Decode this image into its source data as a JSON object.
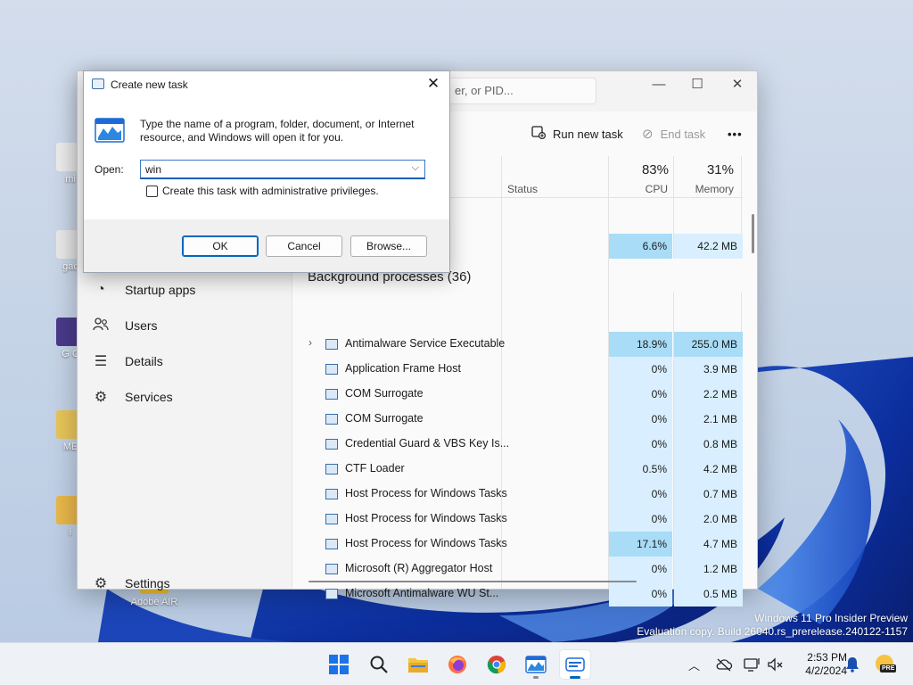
{
  "desktop": {
    "icons": [
      {
        "label": "mi"
      },
      {
        "label": "gac"
      },
      {
        "label": "G C"
      },
      {
        "label": "ME"
      },
      {
        "label": "i"
      },
      {
        "label": "Adobe AIR"
      }
    ],
    "watermark": {
      "line1": "Windows 11 Pro Insider Preview",
      "line2": "Evaluation copy. Build 26040.rs_prerelease.240122-1157"
    }
  },
  "task_manager": {
    "search_placeholder": "er, or PID...",
    "window_controls": {
      "minimize": "—",
      "maximize": "☐",
      "close": "✕"
    },
    "toolbar": {
      "run_new_task": "Run new task",
      "end_task": "End task",
      "more": "•••"
    },
    "sidebar": {
      "items": [
        {
          "label": "Startup apps",
          "icon": "speedometer-icon"
        },
        {
          "label": "Users",
          "icon": "users-icon"
        },
        {
          "label": "Details",
          "icon": "details-list-icon"
        },
        {
          "label": "Services",
          "icon": "services-gear-icon"
        }
      ],
      "settings_label": "Settings"
    },
    "columns": {
      "status": "Status",
      "cpu_pct": "83%",
      "cpu": "CPU",
      "memory_pct": "31%",
      "memory": "Memory"
    },
    "app_row": {
      "cpu": "6.6%",
      "memory": "42.2 MB"
    },
    "section_title": "Background processes (36)",
    "processes": [
      {
        "name": "Antimalware Service Executable",
        "cpu": "18.9%",
        "memory": "255.0 MB",
        "expandable": true
      },
      {
        "name": "Application Frame Host",
        "cpu": "0%",
        "memory": "3.9 MB"
      },
      {
        "name": "COM Surrogate",
        "cpu": "0%",
        "memory": "2.2 MB"
      },
      {
        "name": "COM Surrogate",
        "cpu": "0%",
        "memory": "2.1 MB"
      },
      {
        "name": "Credential Guard & VBS Key Is...",
        "cpu": "0%",
        "memory": "0.8 MB"
      },
      {
        "name": "CTF Loader",
        "cpu": "0.5%",
        "memory": "4.2 MB"
      },
      {
        "name": "Host Process for Windows Tasks",
        "cpu": "0%",
        "memory": "0.7 MB"
      },
      {
        "name": "Host Process for Windows Tasks",
        "cpu": "0%",
        "memory": "2.0 MB"
      },
      {
        "name": "Host Process for Windows Tasks",
        "cpu": "17.1%",
        "memory": "4.7 MB"
      },
      {
        "name": "Microsoft (R) Aggregator Host",
        "cpu": "0%",
        "memory": "1.2 MB"
      },
      {
        "name": "Microsoft Antimalware WU St...",
        "cpu": "0%",
        "memory": "0.5 MB"
      }
    ],
    "colors": {
      "cell_light": "#d9efff",
      "cell_strong": "#a9dcf6"
    }
  },
  "run_dialog": {
    "title": "Create new task",
    "close": "✕",
    "description": "Type the name of a program, folder, document, or Internet resource, and Windows will open it for you.",
    "open_label": "Open:",
    "open_value": "win",
    "admin_checkbox": "Create this task with administrative privileges.",
    "admin_checked": false,
    "buttons": {
      "ok": "OK",
      "cancel": "Cancel",
      "browse": "Browse..."
    }
  },
  "taskbar": {
    "apps": [
      "start-icon",
      "search-icon",
      "file-explorer-icon",
      "firefox-icon",
      "chrome-icon",
      "task-manager-icon",
      "run-dialog-icon"
    ],
    "clock_time": "2:53 PM",
    "clock_date": "4/2/2024",
    "pre_badge": "PRE"
  }
}
